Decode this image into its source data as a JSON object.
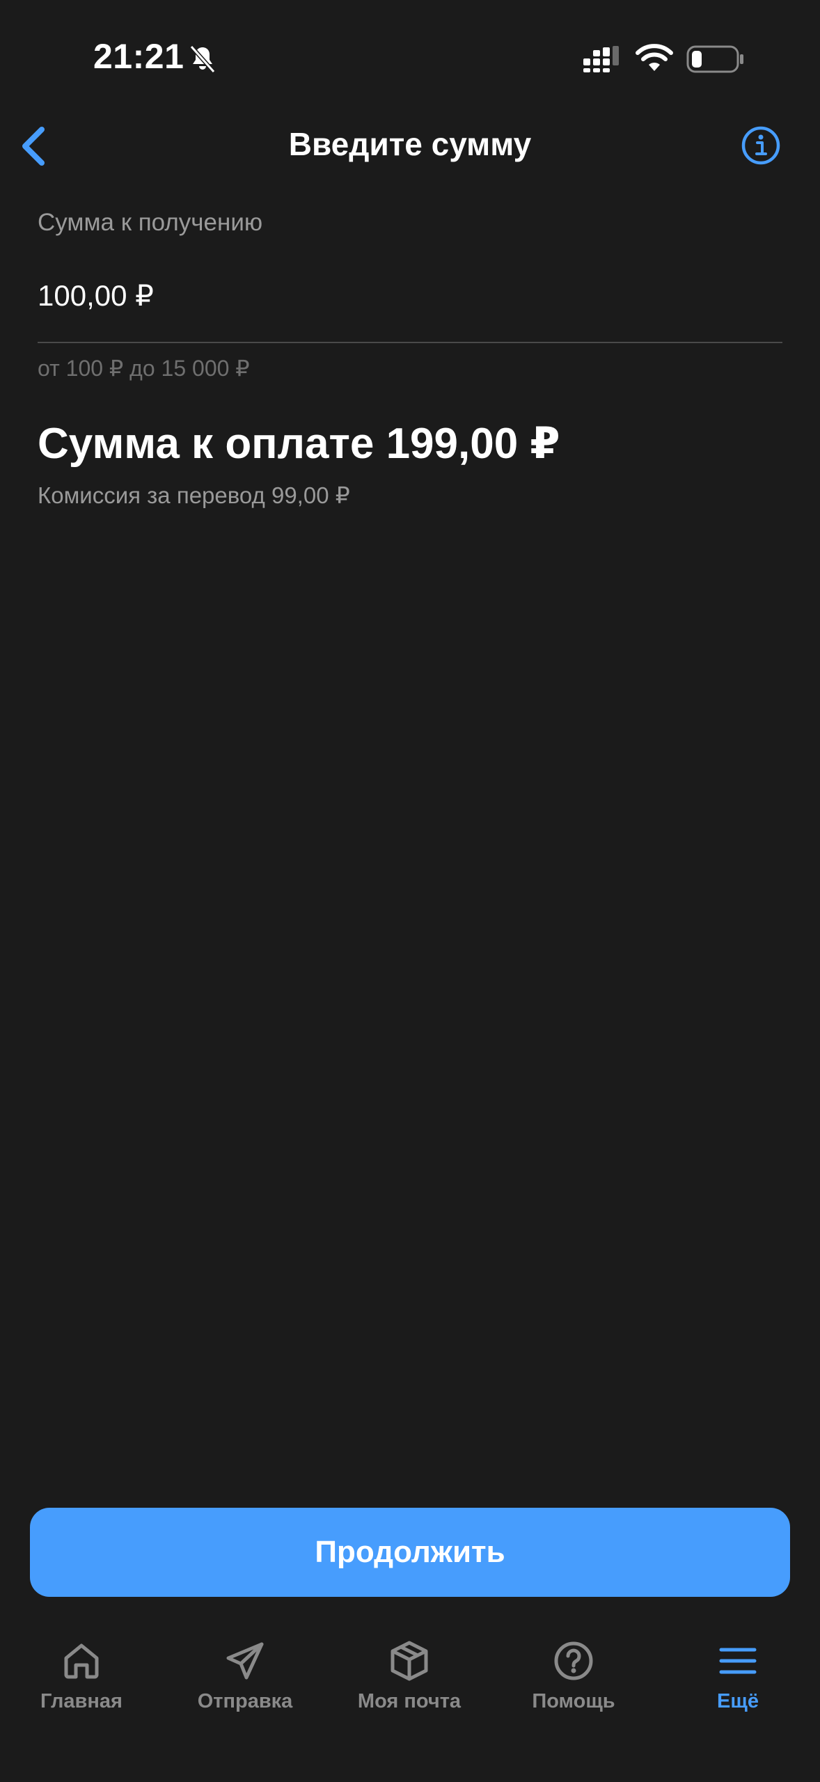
{
  "status_bar": {
    "time": "21:21",
    "icons": [
      "bell-slash-icon",
      "signal-icon",
      "wifi-icon",
      "battery-icon"
    ]
  },
  "header": {
    "title": "Введите сумму",
    "back_icon": "chevron-left-icon",
    "info_icon": "info-icon"
  },
  "form": {
    "receive_label": "Сумма к получению",
    "receive_value": "100,00 ₽",
    "range_hint": "от 100 ₽ до 15 000 ₽"
  },
  "summary": {
    "total": "Сумма к оплате 199,00 ₽",
    "commission": "Комиссия за перевод 99,00 ₽"
  },
  "actions": {
    "continue_label": "Продолжить"
  },
  "tabs": [
    {
      "label": "Главная",
      "icon": "home-icon",
      "active": false
    },
    {
      "label": "Отправка",
      "icon": "paper-plane-icon",
      "active": false
    },
    {
      "label": "Моя почта",
      "icon": "package-icon",
      "active": false
    },
    {
      "label": "Помощь",
      "icon": "question-circle-icon",
      "active": false
    },
    {
      "label": "Ещё",
      "icon": "menu-icon",
      "active": true
    }
  ],
  "colors": {
    "background": "#1b1b1b",
    "accent": "#479dfd",
    "muted_text": "#9a9a9a",
    "inactive_tab": "#8a8a8a"
  }
}
